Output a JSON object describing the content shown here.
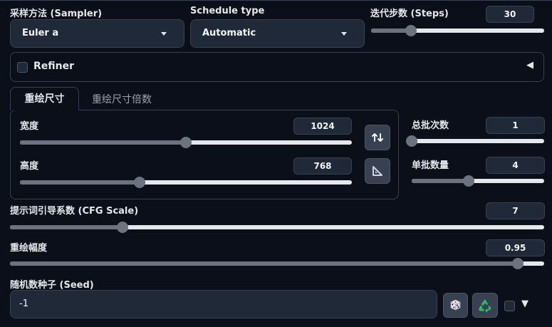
{
  "sampler": {
    "label": "采样方法 (Sampler)",
    "value": "Euler a"
  },
  "schedule": {
    "label": "Schedule type",
    "value": "Automatic"
  },
  "steps": {
    "label": "迭代步数 (Steps)",
    "value": "30",
    "fraction": 0.23
  },
  "refiner": {
    "label": "Refiner",
    "collapse_glyph": "◀"
  },
  "tabs": [
    {
      "label": "重绘尺寸"
    },
    {
      "label": "重绘尺寸倍数"
    }
  ],
  "width": {
    "label": "宽度",
    "value": "1024",
    "fraction": 0.5
  },
  "height": {
    "label": "高度",
    "value": "768",
    "fraction": 0.36
  },
  "batch_count": {
    "label": "总批次数",
    "value": "1",
    "fraction": 0.0
  },
  "batch_size": {
    "label": "单批数量",
    "value": "4",
    "fraction": 0.43
  },
  "cfg": {
    "label": "提示词引导系数 (CFG Scale)",
    "value": "7",
    "fraction": 0.21
  },
  "denoise": {
    "label": "重绘幅度",
    "value": "0.95",
    "fraction": 0.95
  },
  "seed": {
    "label": "随机数种子 (Seed)",
    "value": "-1",
    "expand_glyph": "▼"
  },
  "icons": {
    "swap": "swap-dimensions-icon",
    "ratio": "triangle-ruler-icon",
    "dice": "dice-icon",
    "recycle": "recycle-icon",
    "recycle_color": "#22c55e"
  }
}
